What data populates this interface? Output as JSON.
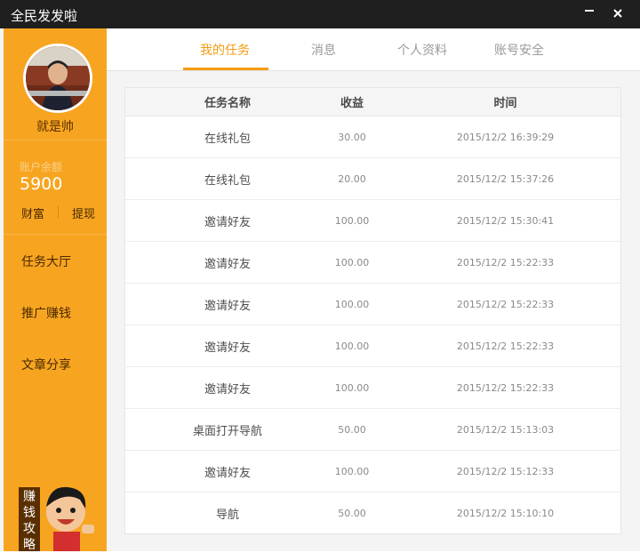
{
  "window": {
    "title": "全民发发啦"
  },
  "sidebar": {
    "username": "就是帅",
    "balance_label": "账户余额",
    "balance_value": "5900",
    "link_wealth": "财富",
    "link_withdraw": "提现",
    "nav": [
      "任务大厅",
      "推广赚钱",
      "文章分享"
    ],
    "promo_text": "赚钱攻略"
  },
  "tabs": [
    "我的任务",
    "消息",
    "个人资料",
    "账号安全"
  ],
  "table": {
    "headers": [
      "任务名称",
      "收益",
      "时间"
    ],
    "rows": [
      [
        "在线礼包",
        "30.00",
        "2015/12/2 16:39:29"
      ],
      [
        "在线礼包",
        "20.00",
        "2015/12/2 15:37:26"
      ],
      [
        "邀请好友",
        "100.00",
        "2015/12/2 15:30:41"
      ],
      [
        "邀请好友",
        "100.00",
        "2015/12/2 15:22:33"
      ],
      [
        "邀请好友",
        "100.00",
        "2015/12/2 15:22:33"
      ],
      [
        "邀请好友",
        "100.00",
        "2015/12/2 15:22:33"
      ],
      [
        "邀请好友",
        "100.00",
        "2015/12/2 15:22:33"
      ],
      [
        "桌面打开导航",
        "50.00",
        "2015/12/2 15:13:03"
      ],
      [
        "邀请好友",
        "100.00",
        "2015/12/2 15:12:33"
      ],
      [
        "导航",
        "50.00",
        "2015/12/2 15:10:10"
      ]
    ]
  },
  "colors": {
    "accent": "#f7a521",
    "tab_active": "#f39c12",
    "titlebar": "#1f1f1f"
  },
  "icons": {
    "minimize": "minimize-icon",
    "close": "close-icon"
  }
}
